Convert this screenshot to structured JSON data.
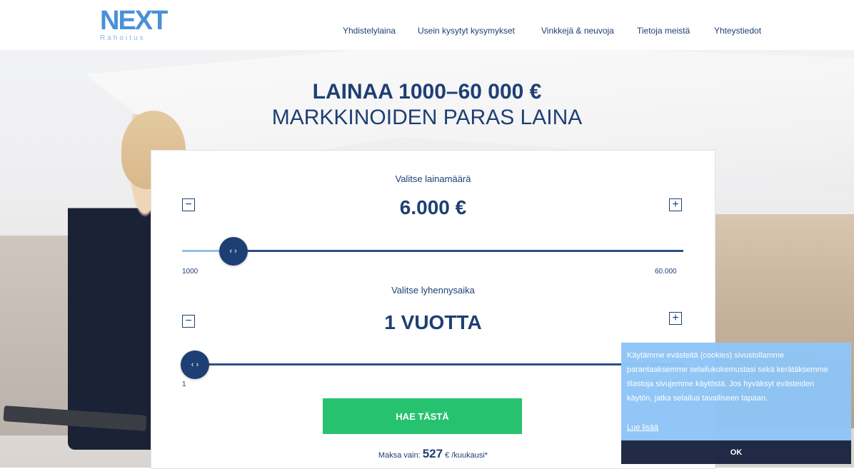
{
  "brand": {
    "logo_main": "NEXT",
    "logo_sub": "Rahoitus"
  },
  "nav": {
    "items": [
      {
        "label": "Yhdistelylaina"
      },
      {
        "label": "Usein kysytyt kysymykset"
      },
      {
        "label": "Vinkkejä & neuvoja"
      },
      {
        "label": "Tietoja meistä"
      },
      {
        "label": "Yhteystiedot"
      }
    ]
  },
  "hero": {
    "title": "LAINAA 1000–60 000 €",
    "subtitle": "MARKKINOIDEN PARAS LAINA"
  },
  "calculator": {
    "amount": {
      "label": "Valitse lainamäärä",
      "value": "6.000 €",
      "min": "1000",
      "max": "60.000",
      "level": 0.085
    },
    "term": {
      "label": "Valitse lyhennysaika",
      "value": "1 VUOTTA",
      "min": "1",
      "level": 0.0
    },
    "minus_symbol": "−",
    "plus_symbol": "+",
    "knob_symbol": "‹ ›",
    "cta_label": "HAE TÄSTÄ",
    "payment": {
      "prefix": "Maksa vain:",
      "amount": "527",
      "suffix": "€ /kuukausi*"
    }
  },
  "cookie": {
    "text": "Käytämme evästeitä (cookies) sivustollamme parantaaksemme selailukokemustasi sekä kerätäksemme tilastoja sivujemme käytöstä. Jos hyväksyt evästeiden käytön, jatka selailua tavalliseen tapaan.",
    "link": "Lue lisää",
    "ok_label": "OK"
  },
  "colors": {
    "primary": "#1e3f73",
    "accent_green": "#27c26f",
    "cookie_bg": "#8ec5f6",
    "cookie_button": "#1a2541"
  }
}
